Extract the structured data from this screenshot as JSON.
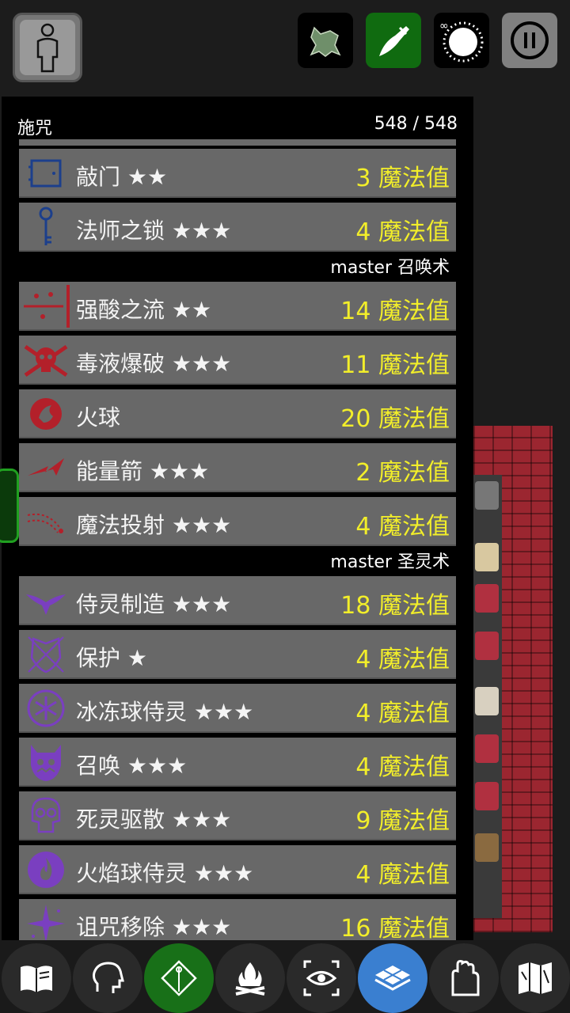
{
  "panel": {
    "title": "施咒",
    "mana": "548 / 548"
  },
  "spells_top": [
    {
      "name": "敲门 ★★",
      "cost": "3 魔法值",
      "icon": "door-icon"
    },
    {
      "name": "法师之锁 ★★★",
      "cost": "4 魔法值",
      "icon": "key-icon"
    }
  ],
  "school_conjuration": "master 召唤术",
  "spells_conjuration": [
    {
      "name": "强酸之流 ★★",
      "cost": "14 魔法值",
      "icon": "acid-stream-icon"
    },
    {
      "name": "毒液爆破 ★★★",
      "cost": "11 魔法值",
      "icon": "skull-crossbones-icon"
    },
    {
      "name": "火球",
      "cost": "20 魔法值",
      "icon": "fireball-icon"
    },
    {
      "name": "能量箭 ★★★",
      "cost": "2 魔法值",
      "icon": "lightning-bolt-icon"
    },
    {
      "name": "魔法投射 ★★★",
      "cost": "4 魔法值",
      "icon": "magic-missile-icon"
    }
  ],
  "school_sorcery": "master 圣灵术",
  "spells_sorcery": [
    {
      "name": "侍灵制造 ★★★",
      "cost": "18 魔法值",
      "icon": "familiar-icon"
    },
    {
      "name": "保护 ★",
      "cost": "4 魔法值",
      "icon": "shield-icon"
    },
    {
      "name": "冰冻球侍灵 ★★★",
      "cost": "4 魔法值",
      "icon": "snowflake-icon"
    },
    {
      "name": "召唤 ★★★",
      "cost": "4 魔法值",
      "icon": "demon-face-icon"
    },
    {
      "name": "死灵驱散 ★★★",
      "cost": "9 魔法值",
      "icon": "skull-icon"
    },
    {
      "name": "火焰球侍灵 ★★★",
      "cost": "4 魔法值",
      "icon": "flame-icon"
    },
    {
      "name": "诅咒移除 ★★★",
      "cost": "16 魔法值",
      "icon": "sparkle-icon"
    }
  ],
  "colors": {
    "cost": "#f2ee2a",
    "row_bg": "#686868",
    "conjuration_icon": "#b3202a",
    "sorcery_icon": "#7a3fc0",
    "utility_icon": "#1c3f8c"
  }
}
